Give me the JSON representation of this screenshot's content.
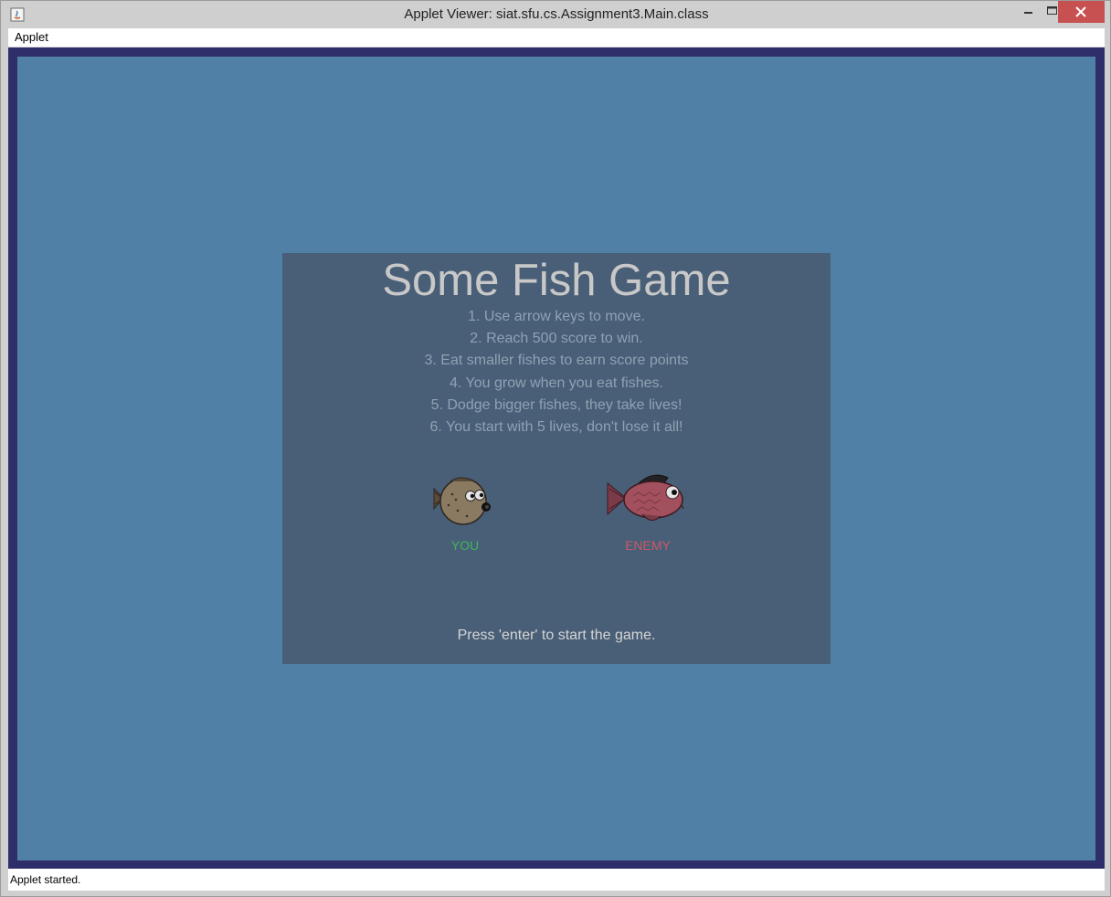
{
  "window": {
    "title": "Applet Viewer: siat.sfu.cs.Assignment3.Main.class"
  },
  "menubar": {
    "items": [
      "Applet"
    ]
  },
  "game": {
    "title": "Some Fish Game",
    "instructions": [
      "1. Use arrow keys to move.",
      "2. Reach 500 score to win.",
      "3. Eat smaller fishes to earn score points",
      "4. You grow when you eat fishes.",
      "5. Dodge bigger fishes, they take lives!",
      "6. You start with 5 lives, don't lose it all!"
    ],
    "you_label": "YOU",
    "enemy_label": "ENEMY",
    "start_prompt": "Press 'enter' to start the game.",
    "colors": {
      "background": "#5180a7",
      "border": "#2e2f6a",
      "panel": "#495f77",
      "you": "#3fb55a",
      "enemy": "#c85a67"
    }
  },
  "status": {
    "text": "Applet started."
  }
}
